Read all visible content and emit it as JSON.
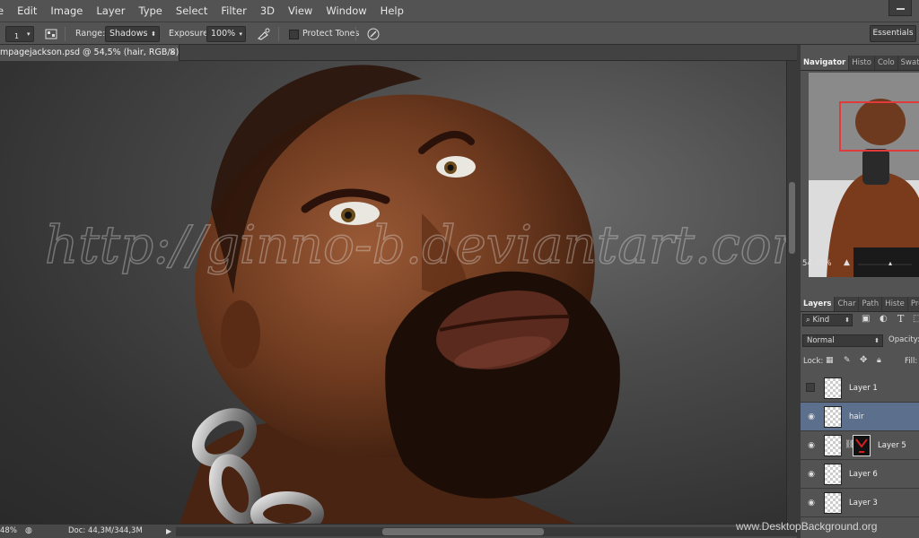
{
  "menu": [
    "e",
    "Edit",
    "Image",
    "Layer",
    "Type",
    "Select",
    "Filter",
    "3D",
    "View",
    "Window",
    "Help"
  ],
  "options": {
    "brush_size": "1",
    "range_label": "Range:",
    "range_value": "Shadows",
    "exposure_label": "Exposure:",
    "exposure_value": "100%",
    "protect_tones_label": "Protect Tones",
    "workspace": "Essentials"
  },
  "document": {
    "tab_title": "mpagejackson.psd @ 54,5% (hair, RGB/8) *",
    "watermark_text": "http://ginno-b.deviantart.com/"
  },
  "status": {
    "zoom": "48%",
    "doc_size": "Doc: 44,3M/344,3M"
  },
  "navigator": {
    "tabs": [
      "Navigator",
      "Histo",
      "Colo",
      "Swat",
      "S"
    ],
    "zoom": "54,48%"
  },
  "layers_panel": {
    "tabs": [
      "Layers",
      "Char",
      "Path",
      "Histe",
      "Prop"
    ],
    "filter_kind": "Kind",
    "blend_mode": "Normal",
    "opacity_label": "Opacity:",
    "lock_label": "Lock:",
    "fill_label": "Fill:",
    "layers": [
      {
        "name": "Layer 1",
        "visible": false,
        "selected": false
      },
      {
        "name": "hair",
        "visible": true,
        "selected": true
      },
      {
        "name": "Layer 5",
        "visible": true,
        "selected": false,
        "has_mask": true
      },
      {
        "name": "Layer 6",
        "visible": true,
        "selected": false
      },
      {
        "name": "Layer 3",
        "visible": true,
        "selected": false
      }
    ]
  },
  "site_watermark": "www.DesktopBackground.org",
  "colors": {
    "selection_blue": "#5c6f8d",
    "navigator_frame": "#e03a3a"
  }
}
